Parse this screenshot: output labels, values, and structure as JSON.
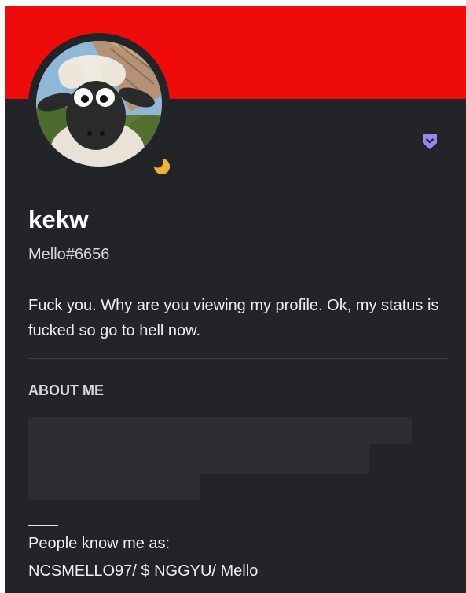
{
  "profile": {
    "display_name": "kekw",
    "tag": "Mello#6656",
    "custom_status": "Fuck you. Why are you viewing my profile. Ok, my status is fucked so go to hell now.",
    "status": "idle",
    "badge_icon": "hypesquad-badge-icon",
    "avatar_icon": "sheep-avatar-icon"
  },
  "about": {
    "title": "ABOUT ME",
    "line1": "People know me as:",
    "line2": "NCSMELLO97/ $ NGGYU/ Mello"
  },
  "colors": {
    "banner": "#f00b0b",
    "card": "#232428",
    "idle": "#f0b232",
    "badge": "#9c84ef"
  }
}
